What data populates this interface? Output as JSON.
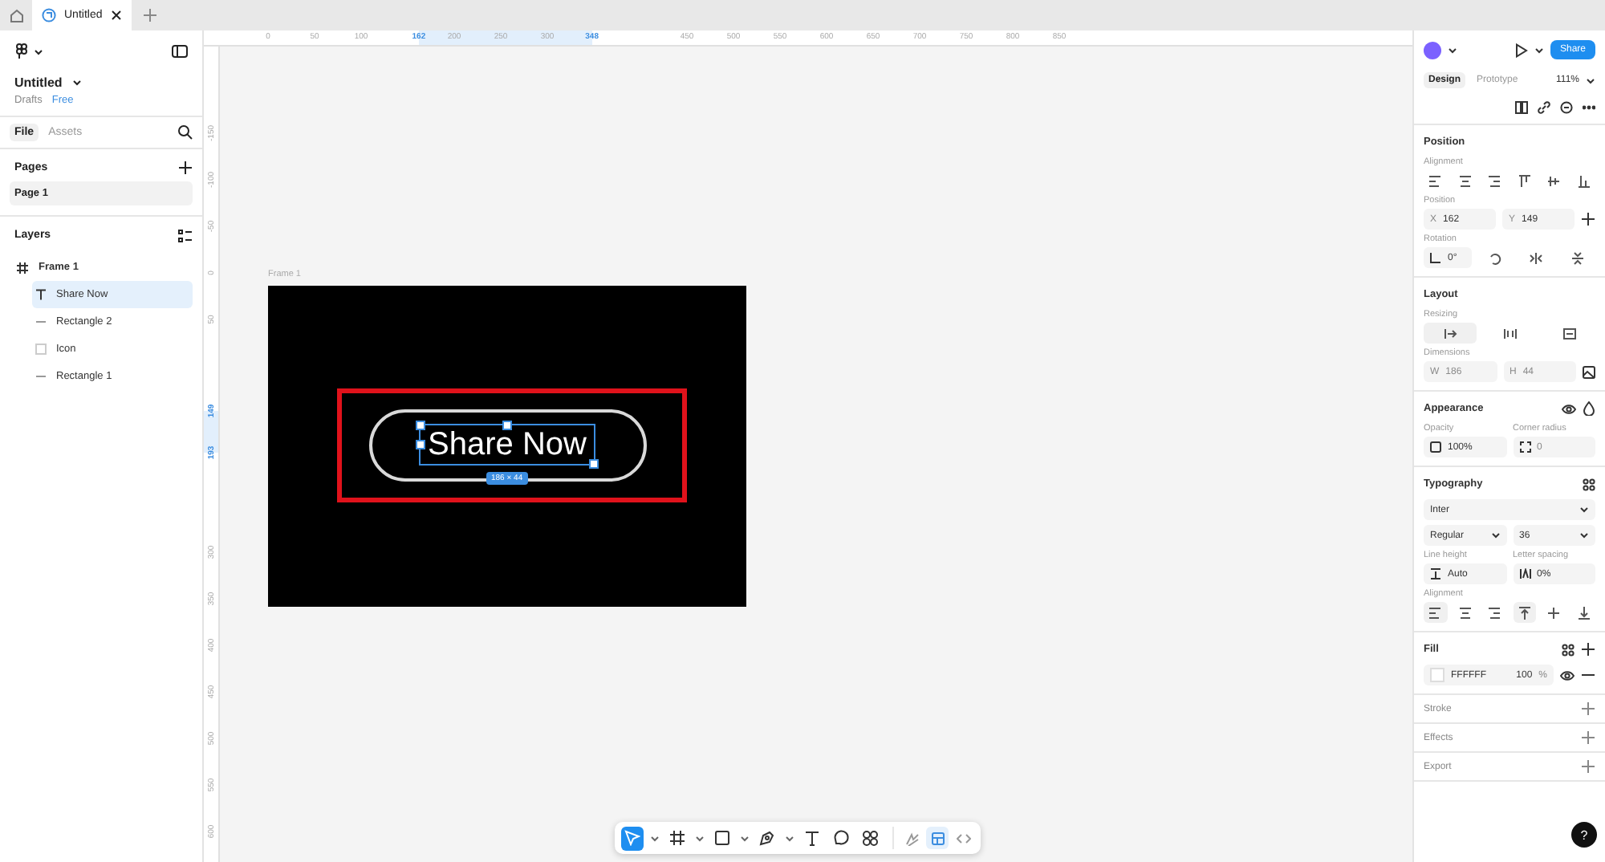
{
  "tabs": [
    {
      "kind": "home",
      "selected": false
    },
    {
      "kind": "file",
      "label": "Untitled",
      "selected": true
    }
  ],
  "file": {
    "name": "Untitled",
    "location": "Drafts",
    "plan": "Free"
  },
  "panel_tabs": [
    {
      "label": "File",
      "selected": true
    },
    {
      "label": "Assets",
      "selected": false
    }
  ],
  "pages": {
    "title": "Pages",
    "items": [
      {
        "label": "Page 1",
        "selected": true
      }
    ]
  },
  "layers": {
    "title": "Layers",
    "items": [
      {
        "label": "Frame 1",
        "kind": "frame",
        "selected": false,
        "children": [
          {
            "label": "Share Now",
            "kind": "text",
            "selected": true
          },
          {
            "label": "Rectangle 2",
            "kind": "rectangle",
            "selected": false
          },
          {
            "label": "Icon",
            "kind": "icon",
            "selected": false
          },
          {
            "label": "Rectangle 1",
            "kind": "rectangle",
            "selected": false
          }
        ]
      }
    ]
  },
  "ruler_x": [
    {
      "label": "0",
      "highlighted": false
    },
    {
      "label": "50",
      "highlighted": false
    },
    {
      "label": "100",
      "highlighted": false
    },
    {
      "label": "162",
      "highlighted": true
    },
    {
      "label": "200",
      "highlighted": false
    },
    {
      "label": "250",
      "highlighted": false
    },
    {
      "label": "300",
      "highlighted": false
    },
    {
      "label": "348",
      "highlighted": true
    },
    {
      "label": "450",
      "highlighted": false
    },
    {
      "label": "500",
      "highlighted": false
    },
    {
      "label": "550",
      "highlighted": false
    },
    {
      "label": "600",
      "highlighted": false
    },
    {
      "label": "650",
      "highlighted": false
    },
    {
      "label": "700",
      "highlighted": false
    },
    {
      "label": "750",
      "highlighted": false
    },
    {
      "label": "800",
      "highlighted": false
    },
    {
      "label": "850",
      "highlighted": false
    }
  ],
  "ruler_y": [
    {
      "label": "-150",
      "highlighted": false
    },
    {
      "label": "-100",
      "highlighted": false
    },
    {
      "label": "-50",
      "highlighted": false
    },
    {
      "label": "0",
      "highlighted": false
    },
    {
      "label": "50",
      "highlighted": false
    },
    {
      "label": "149",
      "highlighted": true
    },
    {
      "label": "193",
      "highlighted": true
    },
    {
      "label": "300",
      "highlighted": false
    },
    {
      "label": "350",
      "highlighted": false
    },
    {
      "label": "400",
      "highlighted": false
    },
    {
      "label": "450",
      "highlighted": false
    },
    {
      "label": "500",
      "highlighted": false
    },
    {
      "label": "550",
      "highlighted": false
    },
    {
      "label": "600",
      "highlighted": false
    }
  ],
  "canvas": {
    "frame_label": "Frame 1",
    "button_text": "Share Now",
    "dimensions": "186 × 44"
  },
  "toolbar": [
    {
      "kind": "move",
      "selected": true,
      "menu": true
    },
    {
      "kind": "frame",
      "selected": false,
      "menu": true
    },
    {
      "kind": "rectangle",
      "selected": false,
      "menu": true
    },
    {
      "kind": "pen",
      "selected": false,
      "menu": true
    },
    {
      "kind": "text",
      "selected": false,
      "menu": false
    },
    {
      "kind": "comment",
      "selected": false,
      "menu": false
    },
    {
      "kind": "components",
      "selected": false,
      "menu": false
    }
  ],
  "modes": [
    {
      "kind": "draw",
      "selected": false
    },
    {
      "kind": "design",
      "selected": true
    },
    {
      "kind": "dev",
      "selected": false
    }
  ],
  "design": {
    "share_button": "Share",
    "zoom": "111%",
    "mode_tabs": [
      {
        "label": "Design",
        "selected": true
      },
      {
        "label": "Prototype",
        "selected": false
      }
    ],
    "position": {
      "title": "Position",
      "alignment_label": "Alignment",
      "position_label": "Position",
      "x": {
        "prefix": "X",
        "value": "162"
      },
      "y": {
        "prefix": "Y",
        "value": "149"
      },
      "rotation_label": "Rotation",
      "rotation": "0°"
    },
    "layout": {
      "title": "Layout",
      "resizing_label": "Resizing",
      "resizing": [
        {
          "kind": "fixed",
          "selected": true
        },
        {
          "kind": "hug",
          "selected": false
        },
        {
          "kind": "fill",
          "selected": false
        }
      ],
      "dimensions_label": "Dimensions",
      "width": {
        "prefix": "W",
        "value": "186",
        "disabled": true
      },
      "height": {
        "prefix": "H",
        "value": "44",
        "disabled": true
      }
    },
    "appearance": {
      "title": "Appearance",
      "opacity_label": "Opacity",
      "opacity": "100%",
      "corner_label": "Corner radius",
      "corner_radius": "0"
    },
    "typography": {
      "title": "Typography",
      "font": "Inter",
      "style": "Regular",
      "size": "36",
      "line_height_label": "Line height",
      "line_height": "Auto",
      "letter_spacing_label": "Letter spacing",
      "letter_spacing": "0%",
      "alignment_label": "Alignment",
      "horizontal": [
        {
          "kind": "left",
          "selected": true
        },
        {
          "kind": "center",
          "selected": false
        },
        {
          "kind": "right",
          "selected": false
        }
      ],
      "vertical": [
        {
          "kind": "top",
          "selected": true
        },
        {
          "kind": "middle",
          "selected": false
        },
        {
          "kind": "bottom",
          "selected": false
        }
      ]
    },
    "fill": {
      "title": "Fill",
      "hex": "FFFFFF",
      "opacity": "100",
      "unit": "%"
    },
    "collapsed_sections": [
      "Stroke",
      "Effects",
      "Export"
    ],
    "help_button": "?"
  }
}
